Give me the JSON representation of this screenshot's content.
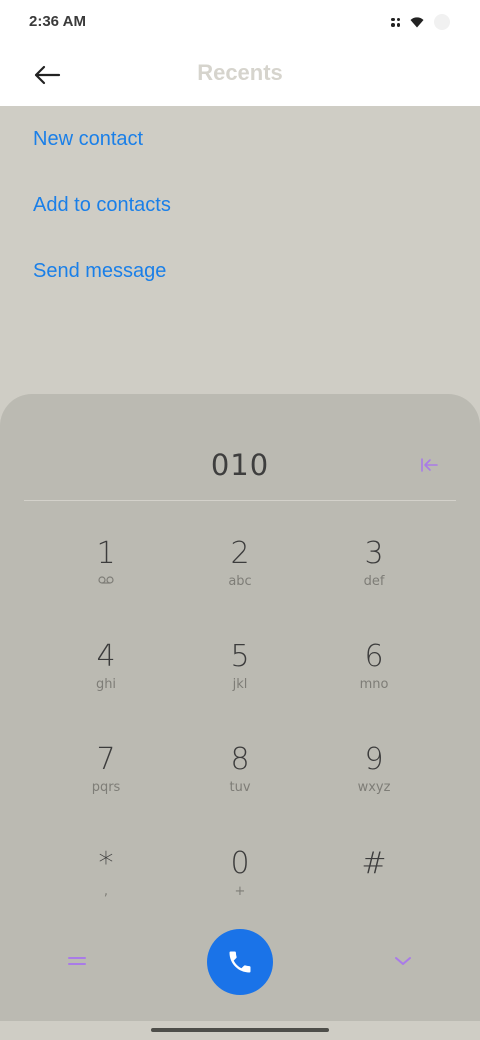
{
  "status_bar": {
    "time": "2:36 AM",
    "icons": [
      "notification-dots-icon",
      "wifi-icon",
      "battery-icon"
    ]
  },
  "app_bar": {
    "title": "Recents",
    "back_icon": "arrow-left-icon"
  },
  "actions": [
    {
      "label": "New contact"
    },
    {
      "label": "Add to contacts"
    },
    {
      "label": "Send message"
    }
  ],
  "dialpad": {
    "number": "010",
    "backspace_icon": "backspace-icon",
    "keys": [
      {
        "digit": "1",
        "letters": "voicemail-icon"
      },
      {
        "digit": "2",
        "letters": "abc"
      },
      {
        "digit": "3",
        "letters": "def"
      },
      {
        "digit": "4",
        "letters": "ghi"
      },
      {
        "digit": "5",
        "letters": "jkl"
      },
      {
        "digit": "6",
        "letters": "mno"
      },
      {
        "digit": "7",
        "letters": "pqrs"
      },
      {
        "digit": "8",
        "letters": "tuv"
      },
      {
        "digit": "9",
        "letters": "wxyz"
      },
      {
        "digit": "*",
        "letters": ","
      },
      {
        "digit": "0",
        "letters": "+"
      },
      {
        "digit": "#",
        "letters": ""
      }
    ],
    "menu_icon": "menu-icon",
    "call_icon": "phone-icon",
    "collapse_icon": "chevron-down-icon"
  },
  "colors": {
    "accent_blue": "#1a7fe8",
    "call_button": "#1a73e8",
    "purple_icons": "#a97be8",
    "dialpad_bg": "#bbbab2",
    "page_bg": "#cfcdc5"
  }
}
